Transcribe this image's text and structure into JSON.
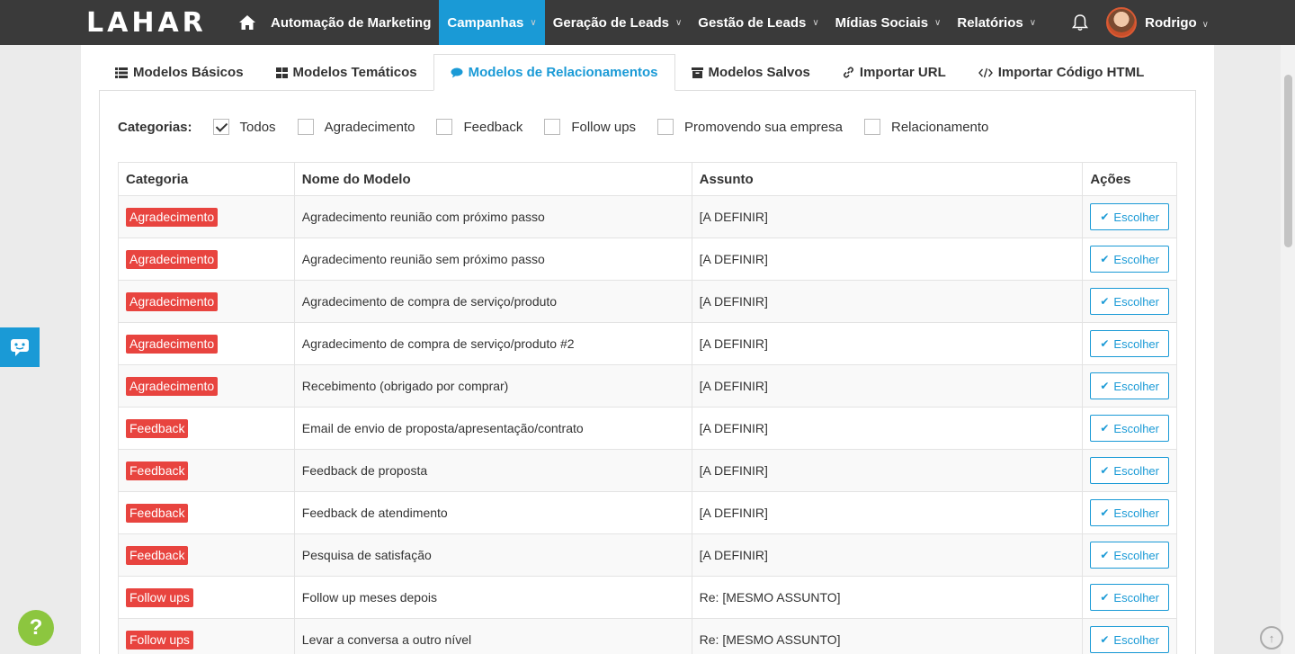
{
  "brand": {
    "logo_text": "LAHAR",
    "accent": "#1a9ad6",
    "badge_color": "#e8443f"
  },
  "nav": {
    "items": [
      {
        "label": "Automação de Marketing",
        "dropdown": false,
        "active": false
      },
      {
        "label": "Campanhas",
        "dropdown": true,
        "active": true
      },
      {
        "label": "Geração de Leads",
        "dropdown": true,
        "active": false
      },
      {
        "label": "Gestão de Leads",
        "dropdown": true,
        "active": false
      },
      {
        "label": "Mídias Sociais",
        "dropdown": true,
        "active": false
      },
      {
        "label": "Relatórios",
        "dropdown": true,
        "active": false
      }
    ],
    "user_name": "Rodrigo",
    "dropdown_glyph": "∨"
  },
  "tabs": [
    {
      "label": "Modelos Básicos",
      "icon": "list-icon",
      "active": false
    },
    {
      "label": "Modelos Temáticos",
      "icon": "grid-icon",
      "active": false
    },
    {
      "label": "Modelos de Relacionamentos",
      "icon": "comments-icon",
      "active": true
    },
    {
      "label": "Modelos Salvos",
      "icon": "archive-icon",
      "active": false
    },
    {
      "label": "Importar URL",
      "icon": "link-icon",
      "active": false
    },
    {
      "label": "Importar Código HTML",
      "icon": "code-icon",
      "active": false
    }
  ],
  "categories": {
    "label": "Categorias:",
    "options": [
      {
        "label": "Todos",
        "checked": true
      },
      {
        "label": "Agradecimento",
        "checked": false
      },
      {
        "label": "Feedback",
        "checked": false
      },
      {
        "label": "Follow ups",
        "checked": false
      },
      {
        "label": "Promovendo sua empresa",
        "checked": false
      },
      {
        "label": "Relacionamento",
        "checked": false
      }
    ]
  },
  "table": {
    "headers": [
      "Categoria",
      "Nome do Modelo",
      "Assunto",
      "Ações"
    ],
    "action_label": "Escolher",
    "rows": [
      {
        "category": "Agradecimento",
        "name": "Agradecimento reunião com próximo passo",
        "subject": "[A DEFINIR]"
      },
      {
        "category": "Agradecimento",
        "name": "Agradecimento reunião sem próximo passo",
        "subject": "[A DEFINIR]"
      },
      {
        "category": "Agradecimento",
        "name": "Agradecimento de compra de serviço/produto",
        "subject": "[A DEFINIR]"
      },
      {
        "category": "Agradecimento",
        "name": "Agradecimento de compra de serviço/produto #2",
        "subject": "[A DEFINIR]"
      },
      {
        "category": "Agradecimento",
        "name": "Recebimento (obrigado por comprar)",
        "subject": "[A DEFINIR]"
      },
      {
        "category": "Feedback",
        "name": "Email de envio de proposta/apresentação/contrato",
        "subject": "[A DEFINIR]"
      },
      {
        "category": "Feedback",
        "name": "Feedback de proposta",
        "subject": "[A DEFINIR]"
      },
      {
        "category": "Feedback",
        "name": "Feedback de atendimento",
        "subject": "[A DEFINIR]"
      },
      {
        "category": "Feedback",
        "name": "Pesquisa de satisfação",
        "subject": "[A DEFINIR]"
      },
      {
        "category": "Follow ups",
        "name": "Follow up meses depois",
        "subject": "Re: [MESMO ASSUNTO]"
      },
      {
        "category": "Follow ups",
        "name": "Levar a conversa a outro nível",
        "subject": "Re: [MESMO ASSUNTO]"
      }
    ]
  },
  "help_glyph": "?",
  "scroll_top_glyph": "↑"
}
